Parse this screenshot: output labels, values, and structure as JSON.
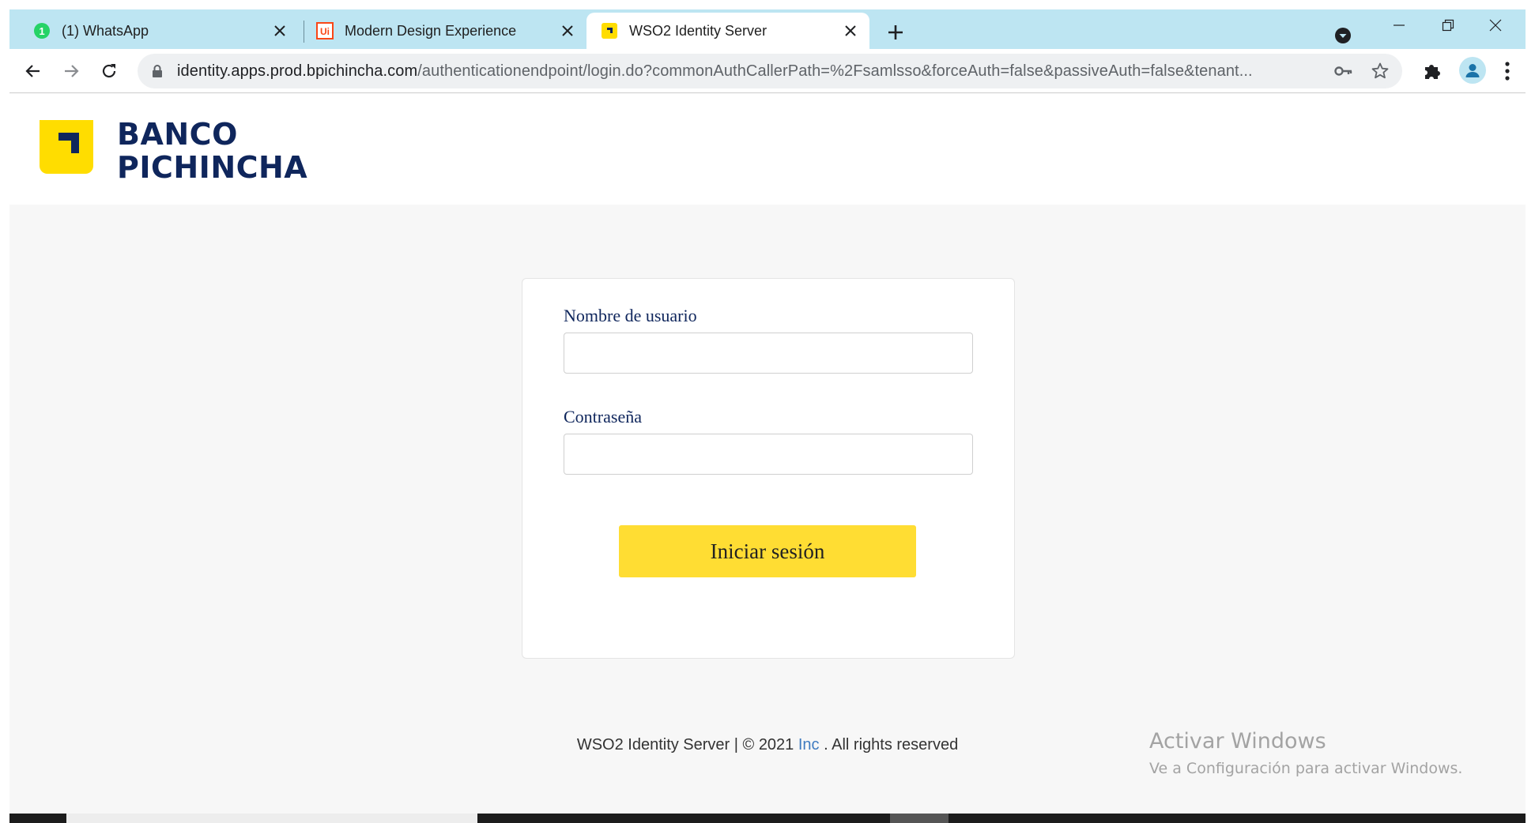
{
  "browser": {
    "tabs": [
      {
        "title": "(1) WhatsApp",
        "icon": "whatsapp-icon",
        "active": false
      },
      {
        "title": "Modern Design Experience",
        "icon": "uipath-icon",
        "active": false
      },
      {
        "title": "WSO2 Identity Server",
        "icon": "banco-pichincha-favicon",
        "active": true
      }
    ],
    "url_domain": "identity.apps.prod.bpichincha.com",
    "url_path": "/authenticationendpoint/login.do?commonAuthCallerPath=%2Fsamlsso&forceAuth=false&passiveAuth=false&tenant..."
  },
  "brand": {
    "line1": "BANCO",
    "line2": "PICHINCHA",
    "color_yellow": "#ffdd00",
    "color_navy": "#0f265c"
  },
  "login": {
    "username_label": "Nombre de usuario",
    "username_value": "",
    "password_label": "Contraseña",
    "password_value": "",
    "submit_label": "Iniciar sesión"
  },
  "footer": {
    "prefix": "WSO2 Identity Server | © 2021 ",
    "link": "Inc",
    "suffix": " . All rights reserved"
  },
  "watermark": {
    "title": "Activar Windows",
    "subtitle": "Ve a Configuración para activar Windows."
  }
}
